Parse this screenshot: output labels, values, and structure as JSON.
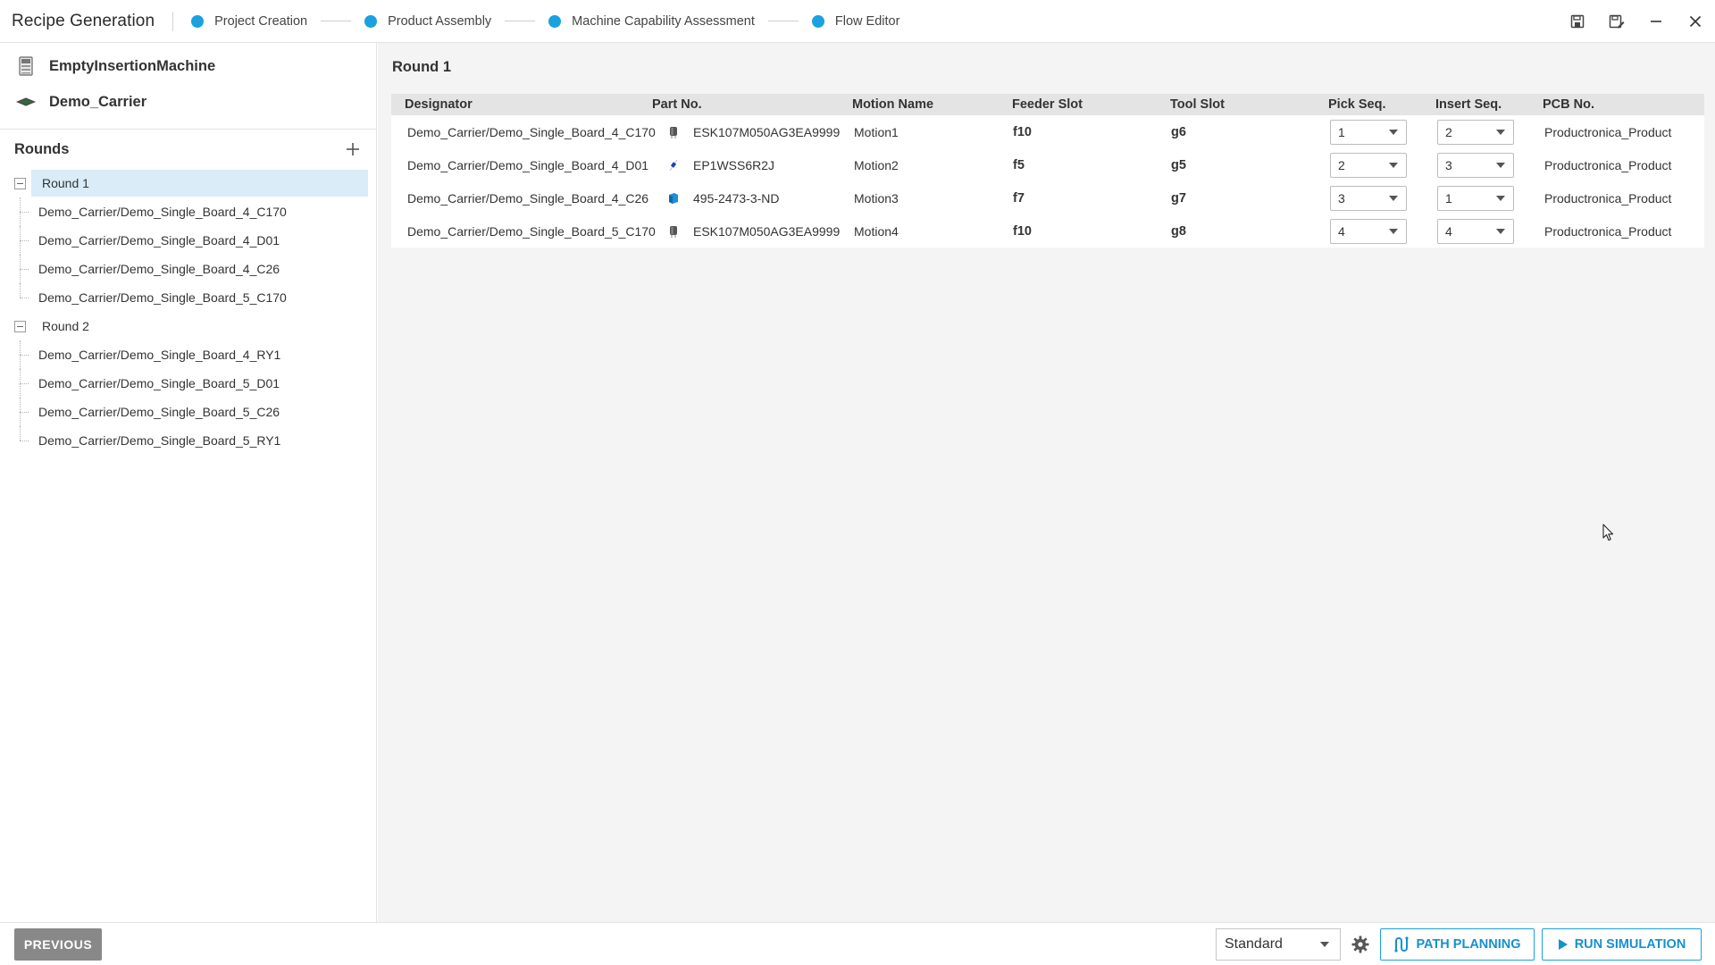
{
  "app": {
    "title": "Recipe Generation",
    "steps": [
      {
        "label": "Project Creation"
      },
      {
        "label": "Product Assembly"
      },
      {
        "label": "Machine Capability Assessment"
      },
      {
        "label": "Flow Editor"
      }
    ],
    "accent_color": "#1aa1e0",
    "icons": {
      "save": "save-icon",
      "save_as": "save-as-icon",
      "minimize": "minimize-icon",
      "close": "close-icon"
    }
  },
  "sidebar": {
    "assets": [
      {
        "name": "EmptyInsertionMachine",
        "icon": "machine-icon"
      },
      {
        "name": "Demo_Carrier",
        "icon": "carrier-icon"
      }
    ],
    "rounds_title": "Rounds",
    "rounds": [
      {
        "label": "Round 1",
        "selected": true,
        "items": [
          "Demo_Carrier/Demo_Single_Board_4_C170",
          "Demo_Carrier/Demo_Single_Board_4_D01",
          "Demo_Carrier/Demo_Single_Board_4_C26",
          "Demo_Carrier/Demo_Single_Board_5_C170"
        ]
      },
      {
        "label": "Round 2",
        "selected": false,
        "items": [
          "Demo_Carrier/Demo_Single_Board_4_RY1",
          "Demo_Carrier/Demo_Single_Board_5_D01",
          "Demo_Carrier/Demo_Single_Board_5_C26",
          "Demo_Carrier/Demo_Single_Board_5_RY1"
        ]
      }
    ]
  },
  "main": {
    "title": "Round 1",
    "columns": [
      "Designator",
      "Part No.",
      "Motion Name",
      "Feeder Slot",
      "Tool Slot",
      "Pick Seq.",
      "Insert Seq.",
      "PCB No."
    ],
    "rows": [
      {
        "designator": "Demo_Carrier/Demo_Single_Board_4_C170",
        "part_icon": "capacitor-icon",
        "part_no": "ESK107M050AG3EA9999",
        "motion": "Motion1",
        "feeder": "f10",
        "tool": "g6",
        "pick": "1",
        "insert": "2",
        "pcb": "Productronica_Product"
      },
      {
        "designator": "Demo_Carrier/Demo_Single_Board_4_D01",
        "part_icon": "diode-icon",
        "part_no": "EP1WSS6R2J",
        "motion": "Motion2",
        "feeder": "f5",
        "tool": "g5",
        "pick": "2",
        "insert": "3",
        "pcb": "Productronica_Product"
      },
      {
        "designator": "Demo_Carrier/Demo_Single_Board_4_C26",
        "part_icon": "capacitor-box-icon",
        "part_no": "495-2473-3-ND",
        "motion": "Motion3",
        "feeder": "f7",
        "tool": "g7",
        "pick": "3",
        "insert": "1",
        "pcb": "Productronica_Product"
      },
      {
        "designator": "Demo_Carrier/Demo_Single_Board_5_C170",
        "part_icon": "capacitor-icon",
        "part_no": "ESK107M050AG3EA9999",
        "motion": "Motion4",
        "feeder": "f10",
        "tool": "g8",
        "pick": "4",
        "insert": "4",
        "pcb": "Productronica_Product"
      }
    ]
  },
  "footer": {
    "previous_label": "PREVIOUS",
    "mode_value": "Standard",
    "path_planning_label": "PATH PLANNING",
    "run_simulation_label": "RUN SIMULATION"
  }
}
